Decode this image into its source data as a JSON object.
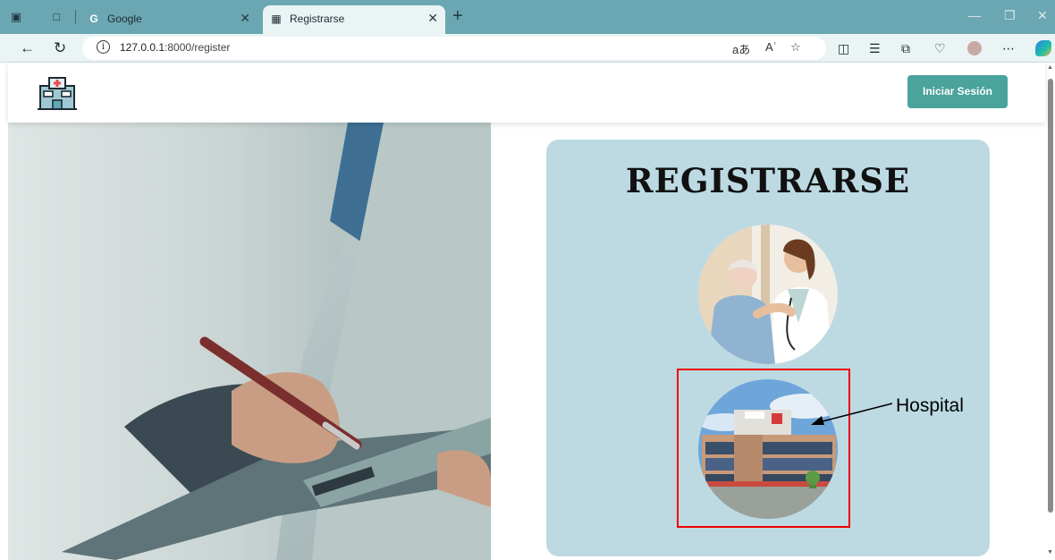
{
  "browser": {
    "tabs": [
      {
        "title": "Google",
        "favicon": "google-g-icon"
      },
      {
        "title": "Registrarse",
        "favicon": "hospital-favicon-icon"
      }
    ],
    "address": {
      "host": "127.0.0.1",
      "rest": ":8000/register"
    }
  },
  "header": {
    "login_label": "Iniciar Sesión",
    "accent": "#4aa39c"
  },
  "card": {
    "title": "REGISTRARSE",
    "background": "#bddae3"
  },
  "annotation": {
    "label": "Hospital",
    "color": "#e00000"
  }
}
